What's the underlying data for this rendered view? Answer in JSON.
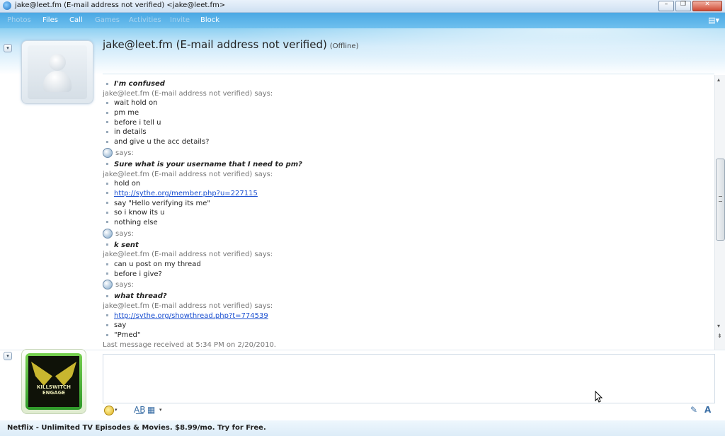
{
  "window": {
    "title": "jake@leet.fm (E-mail address not verified) <jake@leet.fm>",
    "minimize": "–",
    "maximize": "❐",
    "close": "✕"
  },
  "menu": {
    "photos": "Photos",
    "files": "Files",
    "call": "Call",
    "games": "Games",
    "activities": "Activities",
    "invite": "Invite",
    "block": "Block",
    "options_icon": "▤▾"
  },
  "contact": {
    "name": "jake@leet.fm (E-mail address not verified)",
    "status": "(Offline)"
  },
  "conversation": {
    "items": [
      {
        "kind": "mymsg",
        "text": "I'm confused"
      },
      {
        "kind": "says",
        "text": "jake@leet.fm (E-mail address not verified) says:"
      },
      {
        "kind": "msg",
        "text": "wait hold on"
      },
      {
        "kind": "msg",
        "text": "pm me"
      },
      {
        "kind": "msg",
        "text": "before i tell u"
      },
      {
        "kind": "msg",
        "text": "in details"
      },
      {
        "kind": "msg",
        "text": "and give u the acc details?"
      },
      {
        "kind": "mesays",
        "text": "says:"
      },
      {
        "kind": "mymsg",
        "text": "Sure what is your username that I need to pm?"
      },
      {
        "kind": "says",
        "text": "jake@leet.fm (E-mail address not verified) says:"
      },
      {
        "kind": "msg",
        "text": "hold on"
      },
      {
        "kind": "link",
        "text": "http://sythe.org/member.php?u=227115"
      },
      {
        "kind": "msg",
        "text": "say \"Hello verifying its me\""
      },
      {
        "kind": "msg",
        "text": "so i know its u"
      },
      {
        "kind": "msg",
        "text": "nothing else"
      },
      {
        "kind": "mesays",
        "text": "says:"
      },
      {
        "kind": "mymsg",
        "text": "k sent"
      },
      {
        "kind": "says",
        "text": "jake@leet.fm (E-mail address not verified) says:"
      },
      {
        "kind": "msg",
        "text": "can u post on my thread"
      },
      {
        "kind": "msg",
        "text": "before i give?"
      },
      {
        "kind": "mesays",
        "text": "says:"
      },
      {
        "kind": "mymsg",
        "text": "what thread?"
      },
      {
        "kind": "says",
        "text": "jake@leet.fm (E-mail address not verified) says:"
      },
      {
        "kind": "link",
        "text": "http://sythe.org/showthread.php?t=774539"
      },
      {
        "kind": "msg",
        "text": "say"
      },
      {
        "kind": "msg",
        "text": "\"Pmed\""
      },
      {
        "kind": "last",
        "text": "Last message received at 5:34 PM on 2/20/2010."
      }
    ]
  },
  "my_avatar": {
    "album_text": "KILLSWITCH ENGAGE"
  },
  "toolbar": {
    "emoticon_icon": "emoticon-icon",
    "spell_icon": "A͟B",
    "nudge_icon": "▦",
    "handwriting_icon": "✎",
    "font_icon": "A"
  },
  "scrollbar": {
    "up": "▴",
    "down": "▾",
    "bottom": "⇟"
  },
  "ad": {
    "text": "Netflix - Unlimited TV Episodes & Movies. $8.99/mo. Try for Free."
  },
  "colors": {
    "menubar": "#4aa8e4",
    "link": "#1a4fd0"
  }
}
